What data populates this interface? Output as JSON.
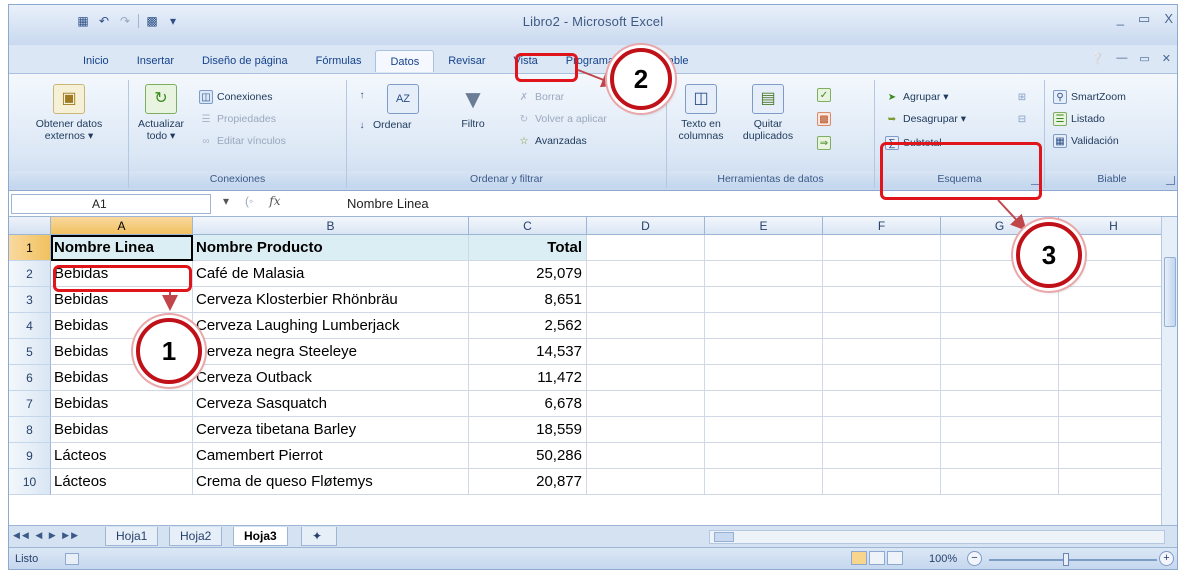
{
  "window": {
    "title": "Libro2 - Microsoft Excel",
    "controls": [
      "_",
      "▭",
      "X"
    ]
  },
  "tabs": [
    {
      "label": "Inicio"
    },
    {
      "label": "Insertar"
    },
    {
      "label": "Diseño de página"
    },
    {
      "label": "Fórmulas"
    },
    {
      "label": "Datos"
    },
    {
      "label": "Revisar"
    },
    {
      "label": "Vista"
    },
    {
      "label": "Programador"
    },
    {
      "label": "Biable"
    }
  ],
  "ribbon": {
    "obtener": {
      "label": "Obtener datos externos ▾"
    },
    "conexiones": {
      "actualizar": "Actualizar todo ▾",
      "conexiones": "Conexiones",
      "propiedades": "Propiedades",
      "editar": "Editar vínculos",
      "group": "Conexiones"
    },
    "ordenar": {
      "ordenar": "Ordenar",
      "filtro": "Filtro",
      "borrar": "Borrar",
      "volver": "Volver a aplicar",
      "avanzadas": "Avanzadas",
      "group": "Ordenar y filtrar"
    },
    "herramientas": {
      "texto": "Texto en columnas",
      "quitar": "Quitar duplicados",
      "group": "Herramientas de datos"
    },
    "esquema": {
      "agrupar": "Agrupar ▾",
      "desagrupar": "Desagrupar ▾",
      "subtotal": "Subtotal",
      "group": "Esquema"
    },
    "biable": {
      "smartzoom": "SmartZoom",
      "listado": "Listado",
      "validacion": "Validación",
      "group": "Biable"
    }
  },
  "formula_bar": {
    "name_box": "A1",
    "fx": "fx",
    "value": "Nombre Linea"
  },
  "sheet": {
    "columns": [
      "A",
      "B",
      "C",
      "D",
      "E",
      "F",
      "G",
      "H"
    ],
    "rows": [
      {
        "n": "1",
        "a": "Nombre Linea",
        "b": "Nombre Producto",
        "c": "Total"
      },
      {
        "n": "2",
        "a": "Bebidas",
        "b": "Café de Malasia",
        "c": "25,079"
      },
      {
        "n": "3",
        "a": "Bebidas",
        "b": "Cerveza Klosterbier Rhönbräu",
        "c": "8,651"
      },
      {
        "n": "4",
        "a": "Bebidas",
        "b": "Cerveza Laughing Lumberjack",
        "c": "2,562"
      },
      {
        "n": "5",
        "a": "Bebidas",
        "b": "Cerveza negra Steeleye",
        "c": "14,537"
      },
      {
        "n": "6",
        "a": "Bebidas",
        "b": "Cerveza Outback",
        "c": "11,472"
      },
      {
        "n": "7",
        "a": "Bebidas",
        "b": "Cerveza Sasquatch",
        "c": "6,678"
      },
      {
        "n": "8",
        "a": "Bebidas",
        "b": "Cerveza tibetana Barley",
        "c": "18,559"
      },
      {
        "n": "9",
        "a": "Lácteos",
        "b": "Camembert Pierrot",
        "c": "50,286"
      },
      {
        "n": "10",
        "a": "Lácteos",
        "b": "Crema de queso Fløtemys",
        "c": "20,877"
      }
    ]
  },
  "sheet_tabs": [
    "Hoja1",
    "Hoja2",
    "Hoja3"
  ],
  "status": {
    "ready": "Listo",
    "zoom": "100%"
  },
  "callouts": [
    "1",
    "2",
    "3"
  ],
  "colors": {
    "highlight": "#e0141b",
    "callout_border": "#c01018"
  }
}
